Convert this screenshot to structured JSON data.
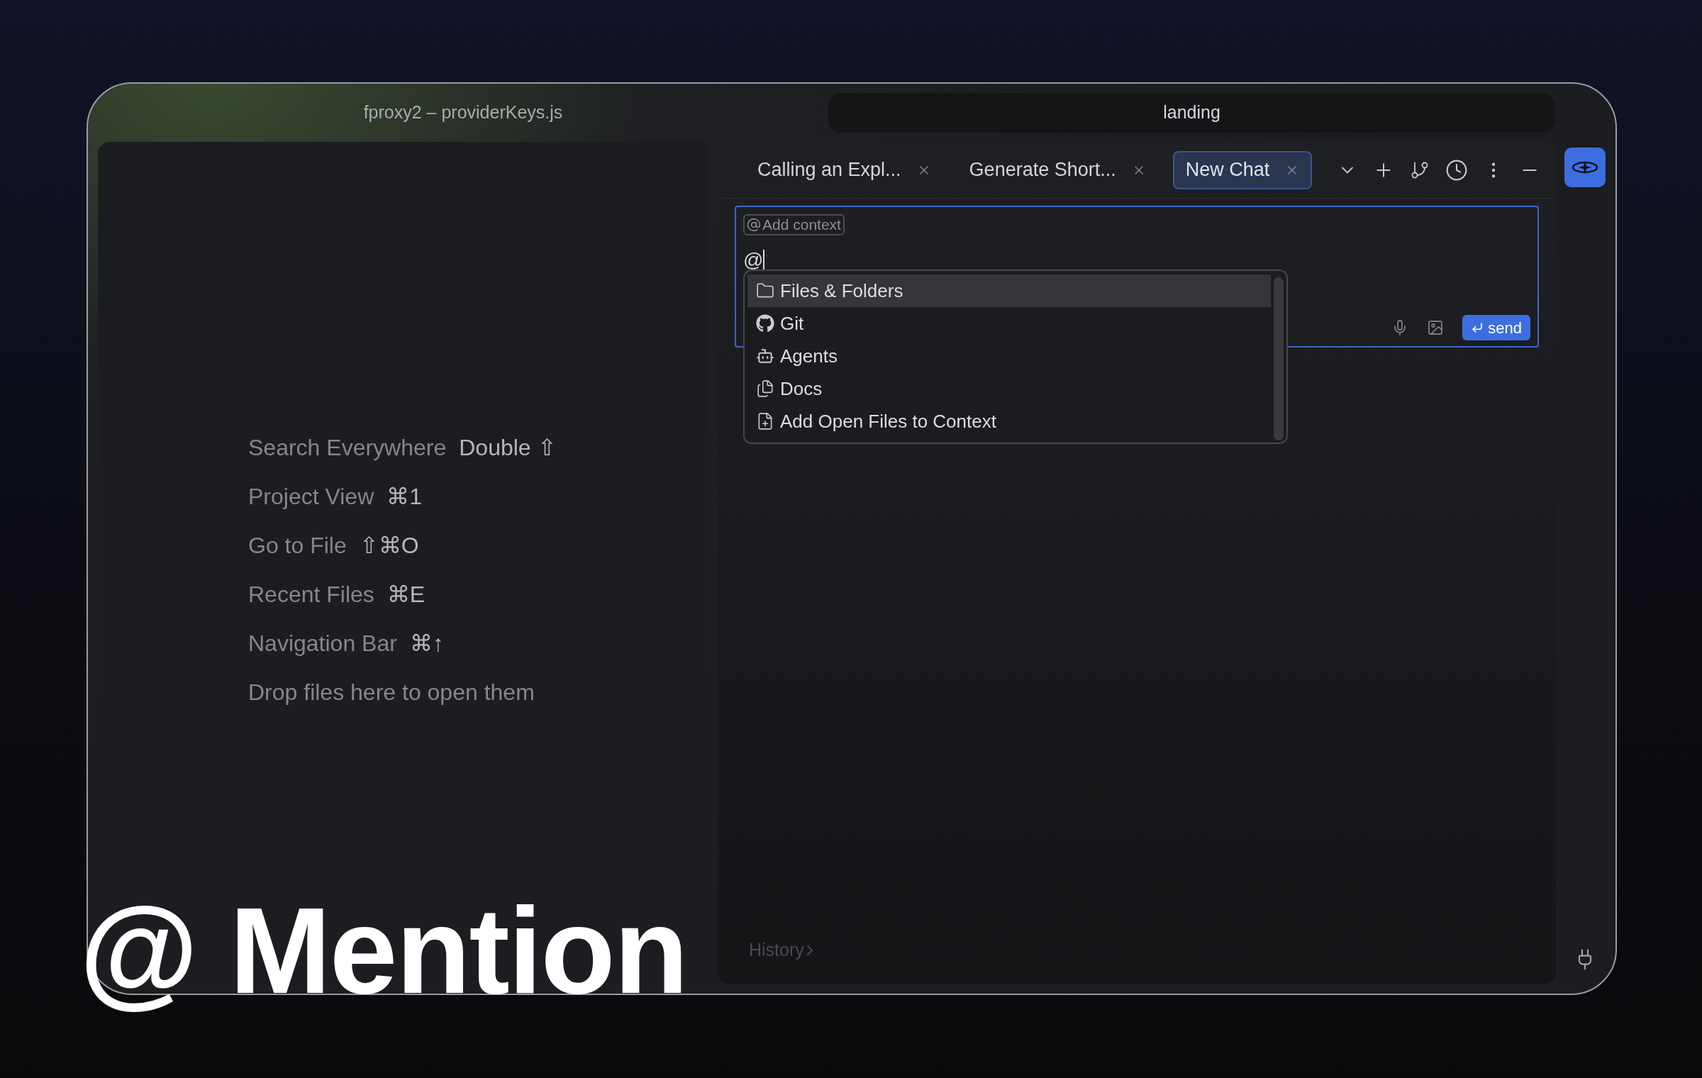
{
  "window": {
    "title": "fproxy2 – providerKeys.js",
    "project_tab": "landing"
  },
  "editor_hints": [
    {
      "label": "Search Everywhere",
      "keys": "Double ⇧"
    },
    {
      "label": "Project View",
      "keys": "⌘1"
    },
    {
      "label": "Go to File",
      "keys": "⇧⌘O"
    },
    {
      "label": "Recent Files",
      "keys": "⌘E"
    },
    {
      "label": "Navigation Bar",
      "keys": "⌘↑"
    },
    {
      "label": "Drop files here to open them"
    }
  ],
  "chat": {
    "tabs": [
      {
        "label": "Calling an Expl...",
        "selected": false
      },
      {
        "label": "Generate Short...",
        "selected": false
      },
      {
        "label": "New Chat",
        "selected": true
      }
    ],
    "context_chip": "Add context",
    "input_value": "@",
    "mention_menu": [
      {
        "kind": "folder",
        "label": "Files & Folders",
        "selected": true
      },
      {
        "kind": "git",
        "label": "Git",
        "selected": false
      },
      {
        "kind": "agent",
        "label": "Agents",
        "selected": false
      },
      {
        "kind": "docs",
        "label": "Docs",
        "selected": false
      },
      {
        "kind": "add_files",
        "label": "Add Open Files to Context",
        "selected": false
      }
    ],
    "send_button": "send",
    "history_link": "History"
  },
  "caption": "@ Mention"
}
